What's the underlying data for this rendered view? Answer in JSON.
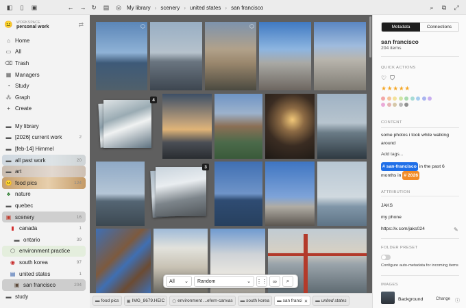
{
  "toolbar": {
    "breadcrumbs": [
      "My library",
      "scenery",
      "united states",
      "san francisco"
    ]
  },
  "sidebar": {
    "workspace_label": "WORKSPACE",
    "workspace_name": "personal work",
    "nav": [
      {
        "label": "Home",
        "icon": "home-icon"
      },
      {
        "label": "All",
        "icon": "folder-icon"
      },
      {
        "label": "Trash",
        "icon": "trash-icon"
      },
      {
        "label": "Managers",
        "icon": "managers-icon"
      },
      {
        "label": "Study",
        "icon": "study-icon"
      },
      {
        "label": "Graph",
        "icon": "graph-icon"
      },
      {
        "label": "Create",
        "icon": "plus-icon"
      }
    ],
    "library": [
      {
        "label": "My library",
        "count": ""
      },
      {
        "label": "[2026] current work",
        "count": "2"
      },
      {
        "label": "[feb-14] Himmel",
        "count": ""
      },
      {
        "label": "all past work",
        "count": "20"
      },
      {
        "label": "art",
        "count": ""
      },
      {
        "label": "food pics",
        "count": "124"
      },
      {
        "label": "nature",
        "count": ""
      },
      {
        "label": "quebec",
        "count": ""
      },
      {
        "label": "scenery",
        "count": "16"
      },
      {
        "label": "canada",
        "count": "1"
      },
      {
        "label": "ontario",
        "count": "39"
      },
      {
        "label": "environment practice",
        "count": ""
      },
      {
        "label": "south korea",
        "count": "97"
      },
      {
        "label": "united states",
        "count": "1"
      },
      {
        "label": "san francisco",
        "count": "204"
      },
      {
        "label": "study",
        "count": ""
      }
    ]
  },
  "grid": {
    "stack_badges": [
      "4",
      "3"
    ]
  },
  "filter_bar": {
    "scope": "All",
    "sort": "Random"
  },
  "tabs": [
    {
      "label": "food pics",
      "icon": "folder-icon"
    },
    {
      "label": "IMG_8679.HEIC",
      "icon": "image-icon"
    },
    {
      "label": "environment ...efern-canvas",
      "icon": "canvas-icon"
    },
    {
      "label": "south korea",
      "icon": "folder-icon"
    },
    {
      "label": "san franci",
      "icon": "folder-icon"
    },
    {
      "label": "united states",
      "icon": "folder-icon"
    }
  ],
  "panel": {
    "tab_metadata": "Metadata",
    "tab_connections": "Connections",
    "title": "san francisco",
    "subtitle": "204 items",
    "quick_actions_label": "QUICK ACTIONS",
    "stars": "★★★★★",
    "content_label": "CONTENT",
    "content_text": "some photos i took while walking around",
    "add_tags": "Add tags...",
    "tag_pill": "# san-francisco",
    "tag_mid": " in the past 6",
    "tag_line2_pre": "months in ",
    "tag_year": "# 2026",
    "attribution_label": "ATTRIBUTION",
    "attr_name": "JAKS",
    "attr_device": "my phone",
    "attr_link": "https://x.com/jaks024",
    "folder_preset_label": "FOLDER PRESET",
    "folder_preset_text": "Configure auto-metadata for incoming items",
    "images_label": "IMAGES",
    "bg_label": "Background",
    "change_label": "Change",
    "colors": [
      "#f2a7a7",
      "#f5c49b",
      "#f3e19a",
      "#cfe6a5",
      "#a8dbb0",
      "#a7dbd5",
      "#a6cdef",
      "#a9b4f0",
      "#c9aef0",
      "#eaaad8",
      "#e5b5b5",
      "#d6c7a8",
      "#b9b9b9",
      "#8f8f8f"
    ],
    "accent_blue": "#1f6fe8",
    "accent_orange": "#f28c28"
  }
}
